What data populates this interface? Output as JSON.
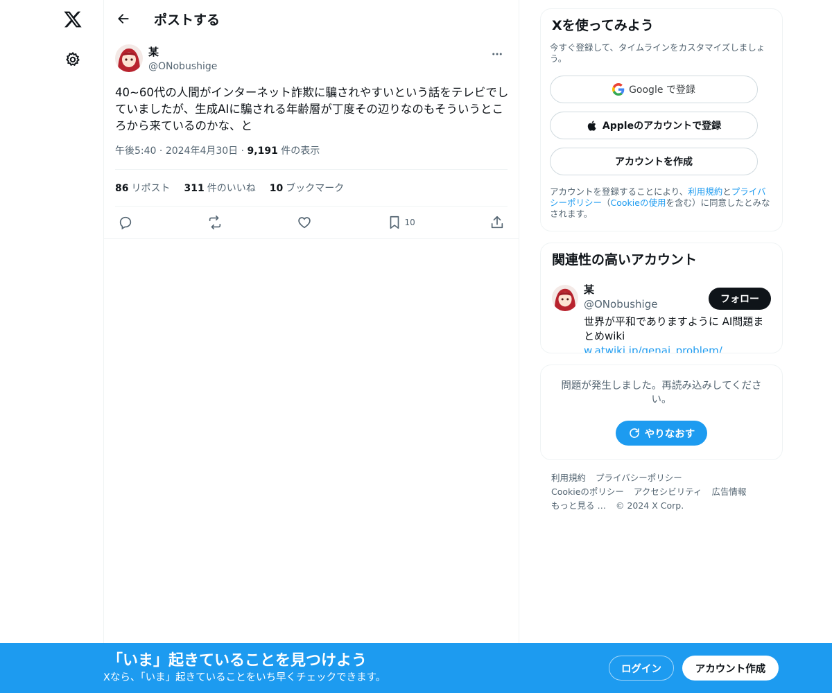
{
  "nav": {
    "logo_icon": "x-logo-icon",
    "settings_icon": "gear-icon"
  },
  "header": {
    "back_icon": "arrow-left-icon",
    "title": "ポストする"
  },
  "post": {
    "author_name": "某",
    "author_handle": "@ONobushige",
    "text": "40~60代の人間がインターネット詐欺に騙されやすいという話をテレビでしていましたが、生成AIに騙される年齢層が丁度その辺りなのもそういうところから来ているのかな、と",
    "time": "午後5:40",
    "date": "2024年4月30日",
    "views_count": "9,191",
    "views_label": "件の表示",
    "reposts_count": "86",
    "reposts_label": "リポスト",
    "likes_count": "311",
    "likes_label": "件のいいね",
    "bookmarks_count": "10",
    "bookmarks_label": "ブックマーク",
    "bookmark_action_count": "10"
  },
  "signup_card": {
    "title": "Xを使ってみよう",
    "subtitle": "今すぐ登録して、タイムラインをカスタマイズしましょう。",
    "google_label": "Google で登録",
    "apple_label": "Appleのアカウントで登録",
    "create_label": "アカウントを作成",
    "legal_prefix": "アカウントを登録することにより、",
    "legal_terms": "利用規約",
    "legal_and": "と",
    "legal_privacy": "プライバシーポリシー",
    "legal_paren_open": "（",
    "legal_cookie": "Cookieの使用",
    "legal_suffix": "を含む）に同意したとみなされます。"
  },
  "reco_card": {
    "title": "関連性の高いアカウント",
    "name": "某",
    "handle": "@ONobushige",
    "bio_text": "世界が平和でありますように AI問題まとめwiki ",
    "bio_link": "w.atwiki.jp/genai_problem/",
    "follow_label": "フォロー"
  },
  "error_card": {
    "text": "問題が発生しました。再読み込みしてください。",
    "retry_label": "やりなおす"
  },
  "footer": {
    "terms": "利用規約",
    "privacy": "プライバシーポリシー",
    "cookie": "Cookieのポリシー",
    "accessibility": "アクセシビリティ",
    "ads": "広告情報",
    "more": "もっと見る …",
    "copyright": "© 2024 X Corp."
  },
  "banner": {
    "title": "「いま」起きていることを見つけよう",
    "subtitle": "Xなら、「いま」起きていることをいち早くチェックできます。",
    "login_label": "ログイン",
    "signup_label": "アカウント作成"
  },
  "colors": {
    "accent": "#1d9bf0",
    "text": "#0f1419",
    "muted": "#536471",
    "border": "#eff3f4"
  }
}
